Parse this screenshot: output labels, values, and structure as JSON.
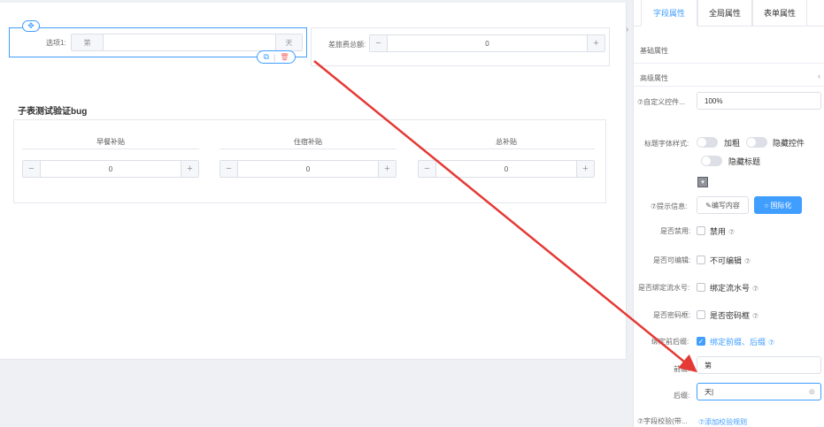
{
  "form": {
    "option_label": "选项1:",
    "option_prefix": "第",
    "option_suffix": "天",
    "travel_label": "差旅费总额:",
    "travel_value": "0",
    "toolbar_copy": "⧉",
    "toolbar_delete": "🗑"
  },
  "subtable": {
    "title": "子表测试验证bug",
    "columns": [
      "早餐补贴",
      "住宿补贴",
      "总补贴"
    ],
    "values": [
      "0",
      "0",
      "0"
    ],
    "minus": "−",
    "plus": "+"
  },
  "panel": {
    "tabs": [
      "字段属性",
      "全局属性",
      "表单属性"
    ],
    "active_tab": 0,
    "basic_section": "基础属性",
    "advanced_section": "高级属性",
    "custom_width_label": "⑦自定义控件...",
    "custom_width_value": "100%",
    "title_style_label": "标题字体样式:",
    "bold_label": "加粗",
    "hide_control_label": "隐藏控件",
    "hide_title_label": "隐藏标题",
    "tip_label": "⑦提示信息:",
    "edit_content_btn": "✎编写内容",
    "i18n_btn": "○ 国际化",
    "disabled_label": "是否禁用:",
    "disabled_text": "禁用",
    "readonly_label": "是否可编辑:",
    "readonly_text": "不可编辑",
    "serial_label": "是否绑定流水号:",
    "serial_text": "绑定流水号",
    "password_label": "是否密码框:",
    "password_text": "是否密码框",
    "affix_label": "绑定前后缀:",
    "affix_text": "绑定前缀、后缀",
    "prefix_label": "前缀:",
    "prefix_value": "第",
    "suffix_label": "后缀:",
    "suffix_value": "天|",
    "validate_label": "⑦字段校验(带...",
    "add_rule_text": "⑦添加校验规则",
    "help_glyph": "⑦",
    "check_glyph": "✓",
    "clear_glyph": "⊗",
    "collapse_glyph": "›",
    "expand_glyph": "‹"
  },
  "colors": {
    "accent": "#409eff",
    "arrow": "#e53935"
  }
}
